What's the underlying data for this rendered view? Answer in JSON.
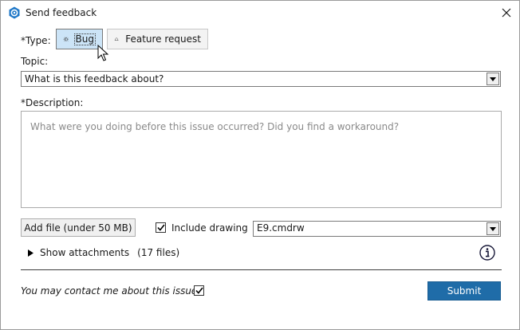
{
  "window": {
    "title": "Send feedback",
    "icon": "gear-hexagon-icon",
    "accent_color": "#1f6ca8"
  },
  "type": {
    "label": "*Type:",
    "options": [
      {
        "label": "Bug",
        "icon": "bug-icon",
        "selected": true
      },
      {
        "label": "Feature request",
        "icon": "bell-icon",
        "selected": false
      }
    ]
  },
  "topic": {
    "label": "Topic:",
    "selected_value": "What is this feedback about?"
  },
  "description": {
    "label": "*Description:",
    "placeholder": "What were you doing before this issue occurred? Did you find a workaround?",
    "value": ""
  },
  "attachments": {
    "add_file_label": "Add file (under 50 MB)",
    "include_drawing_label": "Include drawing",
    "include_drawing_checked": true,
    "drawing_file": "E9.cmdrw",
    "show_attachments_label": "Show attachments",
    "files_count_text": "(17 files)"
  },
  "footer": {
    "contact_label": "You may contact me about this issue",
    "contact_checked": true,
    "submit_label": "Submit"
  }
}
